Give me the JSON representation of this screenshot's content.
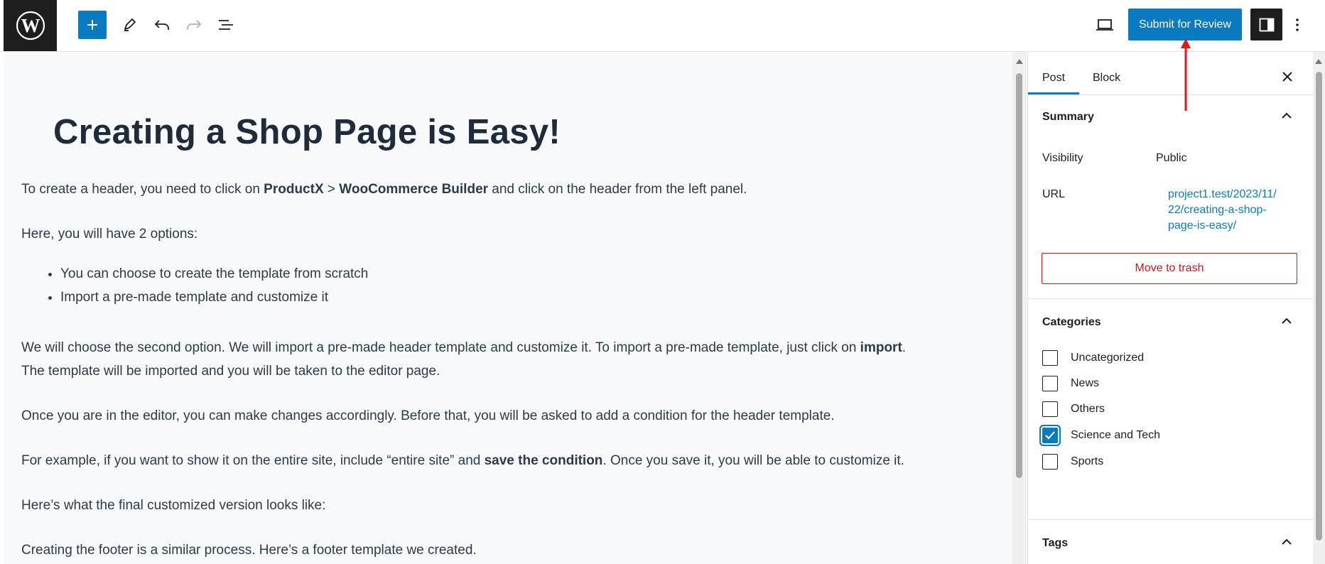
{
  "toolbar": {
    "logo_icon": "wordpress-logo-icon",
    "add_block_icon": "plus-icon",
    "tools_icon": "pencil-icon",
    "undo_icon": "undo-icon",
    "redo_icon": "redo-icon",
    "list_view_icon": "list-view-icon",
    "preview_icon": "laptop-icon",
    "submit_label": "Submit for Review",
    "settings_icon": "sidebar-toggle-icon",
    "options_icon": "kebab-menu-icon",
    "accent_color": "#0a7bc0"
  },
  "post": {
    "title": "Creating a Shop Page is Easy!",
    "p1_a": "To create a header, you need to click on ",
    "p1_b": "ProductX",
    "p1_c": " > ",
    "p1_d": "WooCommerce Builder",
    "p1_e": " and click on the header from the left panel.",
    "p2": "Here, you will have 2 options:",
    "list": [
      "You can choose to create the template from scratch",
      "Import a pre-made template and customize it"
    ],
    "p3_a": "We will choose the second option. We will import a pre-made header template and customize it. To import a pre-made template, just click on ",
    "p3_b": "import",
    "p3_c": ".",
    "p3_line2": "The template will be imported and you will be taken to the editor page.",
    "p4": "Once you are in the editor, you can make changes accordingly. Before that, you will be asked to add a condition for the header template.",
    "p5_a": "For example, if you want to show it on the entire site, include “entire site” and ",
    "p5_b": "save the condition",
    "p5_c": ". Once you save it, you will be able to customize it.",
    "p6": "Here’s what the final customized version looks like:",
    "p7": "Creating the footer is a similar process. Here’s a footer template we created."
  },
  "sidebar": {
    "tabs": [
      "Post",
      "Block"
    ],
    "active_tab": "Post",
    "close_icon": "close-icon",
    "summary": {
      "title": "Summary",
      "visibility_label": "Visibility",
      "visibility_value": "Public",
      "url_label": "URL",
      "url_line1": "project1.test/2023/11/",
      "url_line2": "22/creating-a-shop-",
      "url_line3": "page-is-easy/",
      "trash_label": "Move to trash"
    },
    "categories": {
      "title": "Categories",
      "items": [
        {
          "label": "Uncategorized",
          "checked": false
        },
        {
          "label": "News",
          "checked": false
        },
        {
          "label": "Others",
          "checked": false
        },
        {
          "label": "Science and Tech",
          "checked": true
        },
        {
          "label": "Sports",
          "checked": false
        }
      ]
    },
    "tags": {
      "title": "Tags"
    }
  },
  "annotation": {
    "arrow_color": "#e8141c",
    "points_to": "Submit for Review"
  }
}
